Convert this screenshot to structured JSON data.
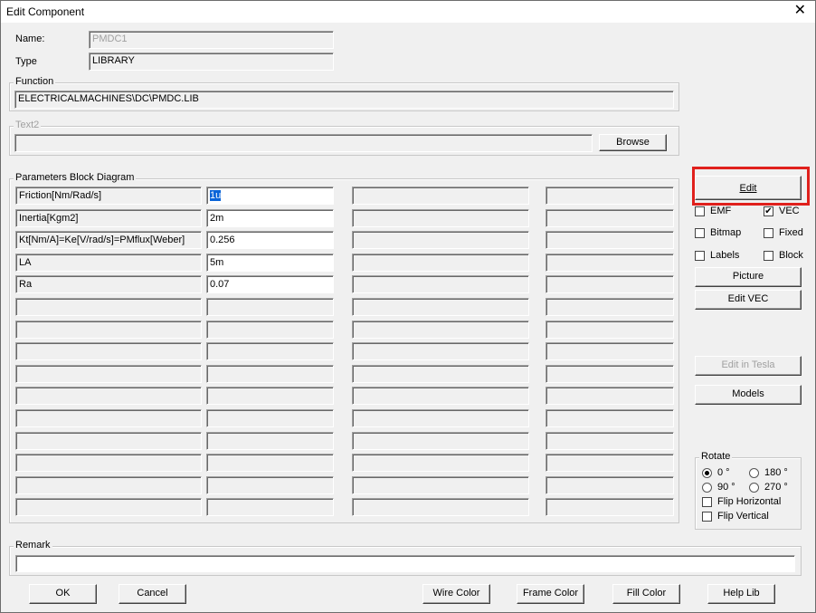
{
  "window": {
    "title": "Edit Component",
    "close": "✕"
  },
  "name": {
    "label": "Name:",
    "value": "PMDC1"
  },
  "type": {
    "label": "Type",
    "value": "LIBRARY"
  },
  "function": {
    "label": "Function",
    "value": "ELECTRICALMACHINES\\DC\\PMDC.LIB"
  },
  "text2": {
    "label": "Text2",
    "value": "",
    "browse": "Browse"
  },
  "params": {
    "label": "Parameters Block Diagram",
    "rows": [
      {
        "name": "Friction[Nm/Rad/s]",
        "value": "1u"
      },
      {
        "name": "Inertia[Kgm2]",
        "value": "2m"
      },
      {
        "name": "Kt[Nm/A]=Ke[V/rad/s]=PMflux[Weber]",
        "value": "0.256"
      },
      {
        "name": "LA",
        "value": "5m"
      },
      {
        "name": "Ra",
        "value": "0.07"
      }
    ]
  },
  "side": {
    "edit": "Edit",
    "emf": "EMF",
    "vec": "VEC",
    "bitmap": "Bitmap",
    "fixed": "Fixed",
    "labels": "Labels",
    "block": "Block",
    "picture": "Picture",
    "edit_vec": "Edit VEC",
    "edit_in_tesla": "Edit in Tesla",
    "models": "Models"
  },
  "rotate": {
    "label": "Rotate",
    "r0": "0 °",
    "r180": "180 °",
    "r90": "90 °",
    "r270": "270 °",
    "flip_h": "Flip Horizontal",
    "flip_v": "Flip Vertical"
  },
  "remark": {
    "label": "Remark",
    "value": ""
  },
  "footer": {
    "ok": "OK",
    "cancel": "Cancel",
    "wire_color": "Wire Color",
    "frame_color": "Frame Color",
    "fill_color": "Fill Color",
    "help_lib": "Help Lib"
  },
  "colors": {
    "highlight": "#e0201c",
    "selection": "#0a64d8"
  }
}
